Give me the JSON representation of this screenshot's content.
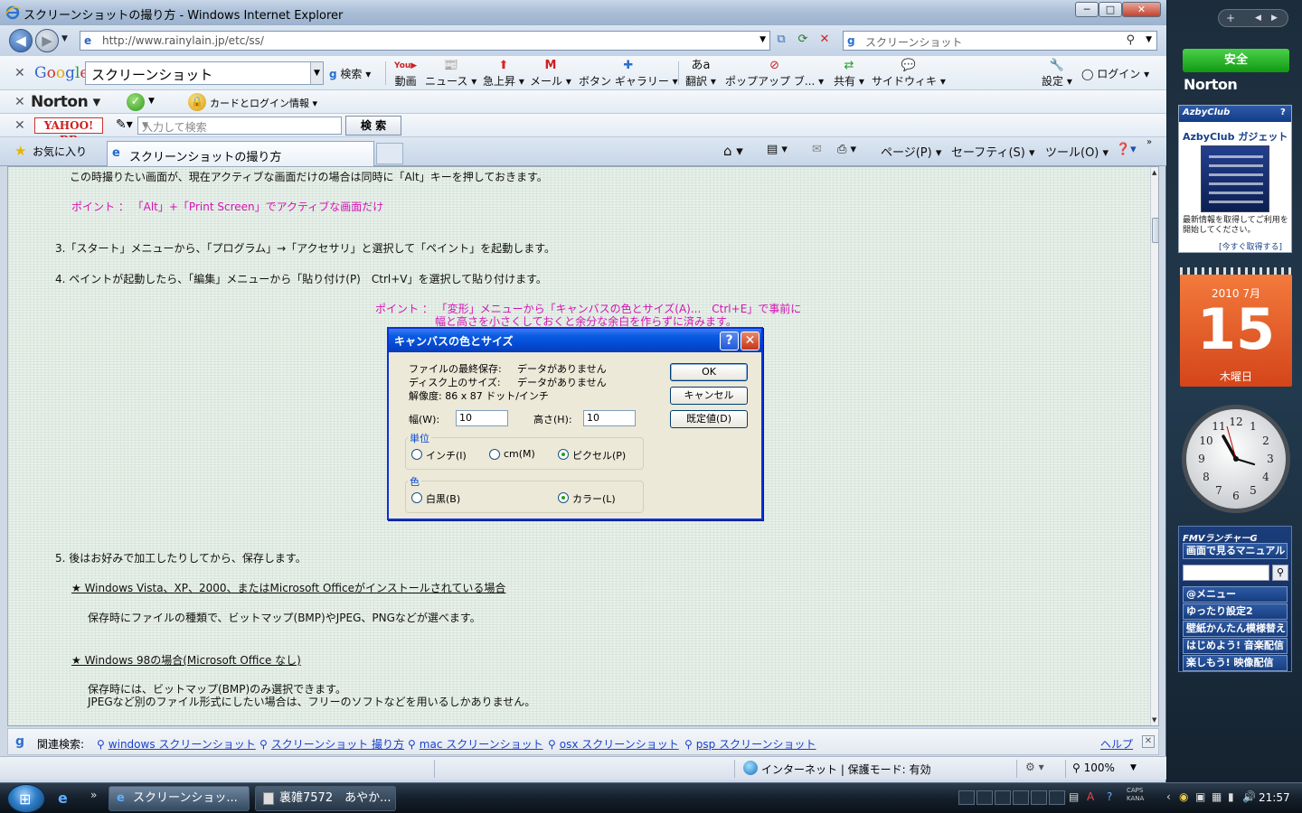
{
  "window": {
    "title": "スクリーンショットの撮り方 - Windows Internet Explorer",
    "minimize": "─",
    "maximize": "□",
    "close": "✕"
  },
  "address_bar": {
    "back": "◀",
    "forward": "▶",
    "url": "http://www.rainylain.jp/etc/ss/",
    "search_placeholder": "スクリーンショット"
  },
  "google_toolbar": {
    "query": "スクリーンショット",
    "search_label": "検索",
    "video_label": "動画",
    "news_label": "ニュース",
    "rising_label": "急上昇",
    "mail_label": "メール",
    "gallery_label": "ボタン ギャラリー",
    "translate_label": "翻訳",
    "popup_label": "ポップアップ ブ...",
    "share_label": "共有",
    "sidewiki_label": "サイドウィキ",
    "settings_label": "設定",
    "login_label": "ログイン"
  },
  "norton_toolbar": {
    "logo": "Norton",
    "card_label": "カードとログイン情報"
  },
  "yahoo_toolbar": {
    "logo": "YAHOO! BB",
    "placeholder": "入力して検索",
    "search_button": "検 索"
  },
  "tab_bar": {
    "favorites": "お気に入り",
    "active_tab": "スクリーンショットの撮り方",
    "page_menu": "ページ(P)",
    "safety_menu": "セーフティ(S)",
    "tools_menu": "ツール(O)"
  },
  "content": {
    "line_alt": "この時撮りたい画面が、現在アクティブな画面だけの場合は同時に「Alt」キーを押しておきます。",
    "point_alt": "ポイント ： 「Alt」+「Print Screen」でアクティブな画面だけ",
    "step3": "3.「スタート」メニューから、「プログラム」→「アクセサリ」と選択して「ペイント」を起動します。",
    "step4": "4. ペイントが起動したら、「編集」メニューから「貼り付け(P)　Ctrl+V」を選択して貼り付けます。",
    "point_canvas_1": "ポイント ： 「変形」メニューから「キャンバスの色とサイズ(A)...　Ctrl+E」で事前に",
    "point_canvas_2": "幅と高さを小さくしておくと余分な余白を作らずに済みます。",
    "step5": "5. 後はお好みで加工したりしてから、保存します。",
    "heading_vista": "★ Windows Vista、XP、2000、またはMicrosoft Officeがインストールされている場合",
    "vista_text": "保存時にファイルの種類で、ビットマップ(BMP)やJPEG、PNGなどが選べます。",
    "heading_98": "★ Windows 98の場合(Microsoft Office なし)",
    "w98_text_1": "保存時には、ビットマップ(BMP)のみ選択できます。",
    "w98_text_2": "JPEGなど別のファイル形式にしたい場合は、フリーのソフトなどを用いるしかありません。"
  },
  "dialog": {
    "title": "キャンバスの色とサイズ",
    "help": "?",
    "close": "✕",
    "last_saved_label": "ファイルの最終保存:",
    "last_saved_value": "データがありません",
    "disk_size_label": "ディスク上のサイズ:",
    "disk_size_value": "データがありません",
    "resolution": "解像度: 86 x 87 ドット/インチ",
    "width_label": "幅(W):",
    "width_value": "10",
    "height_label": "高さ(H):",
    "height_value": "10",
    "ok": "OK",
    "cancel": "キャンセル",
    "default": "既定値(D)",
    "units_title": "単位",
    "unit_inch": "インチ(I)",
    "unit_cm": "cm(M)",
    "unit_pixel": "ピクセル(P)",
    "color_title": "色",
    "color_bw": "白黒(B)",
    "color_color": "カラー(L)"
  },
  "related_bar": {
    "label": "関連検索:",
    "links": [
      "windows スクリーンショット",
      "スクリーンショット 撮り方",
      "mac スクリーンショット",
      "osx スクリーンショット",
      "psp スクリーンショット"
    ],
    "help": "ヘルプ"
  },
  "status_bar": {
    "zone": "インターネット | 保護モード: 有効",
    "zoom": "100%"
  },
  "sidebar": {
    "safe": "安全",
    "norton": "Norton",
    "azby_header": "AzbyClub",
    "azby_title": "AzbyClub ガジェット",
    "azby_note": "最新情報を取得してご利用を開始してください。",
    "azby_link": "[今すぐ取得する]",
    "cal_month": "2010 7月",
    "cal_day": "15",
    "cal_weekday": "木曜日",
    "fmv_title": "FMVランチャーG",
    "fmv_manual": "画面で見るマニュアル",
    "fmv_items": [
      "@メニュー",
      "ゆったり設定2",
      "壁紙かんたん模様替え",
      "はじめよう! 音楽配信",
      "楽しもう! 映像配信"
    ]
  },
  "taskbar": {
    "task_ie": "スクリーンショッ...",
    "task_app": "裏雑7572　あやか...",
    "caps": "CAPS",
    "kana": "KANA",
    "time": "21:57"
  },
  "colors": {
    "pink_text": "#d314b4",
    "link_blue": "#1a3fc9",
    "dialog_title": "#0a5ce4",
    "calendar": "#e0551f"
  }
}
